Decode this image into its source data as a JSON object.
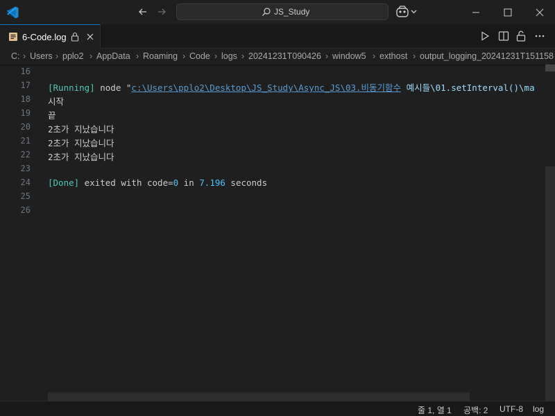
{
  "titlebar": {
    "search_label": "JS_Study",
    "icons": [
      "vscode-logo",
      "arrow-left-icon",
      "arrow-right-icon",
      "search-icon",
      "copilot-icon",
      "minimize-icon",
      "maximize-icon",
      "close-icon"
    ]
  },
  "tab": {
    "label": "6-Code.log",
    "icons": [
      "log-file-icon",
      "lock-icon",
      "close-icon"
    ]
  },
  "editor_actions": [
    "run-icon",
    "split-editor-icon",
    "unlock-icon",
    "more-icon"
  ],
  "breadcrumb": {
    "items": [
      "C:",
      "Users",
      "pplo2",
      "AppData",
      "Roaming",
      "Code",
      "logs",
      "20241231T090426",
      "window5",
      "exthost",
      "output_logging_20241231T151158"
    ]
  },
  "editor": {
    "lines": [
      {
        "num": "16",
        "parts": []
      },
      {
        "num": "17",
        "parts": [
          {
            "t": "[Running]",
            "c": "tk-bracket"
          },
          {
            "t": " node \"",
            "c": ""
          },
          {
            "t": "c:\\Users\\pplo2\\Desktop\\JS_Study\\Async_JS\\03.비동기함수",
            "c": "tk-link"
          },
          {
            "t": " 예시들\\01.setInterval()\\ma",
            "c": "tk-path"
          }
        ]
      },
      {
        "num": "18",
        "parts": [
          {
            "t": "시작",
            "c": ""
          }
        ]
      },
      {
        "num": "19",
        "parts": [
          {
            "t": "끝",
            "c": ""
          }
        ]
      },
      {
        "num": "20",
        "parts": [
          {
            "t": "2초가 지났습니다",
            "c": ""
          }
        ]
      },
      {
        "num": "21",
        "parts": [
          {
            "t": "2초가 지났습니다",
            "c": ""
          }
        ]
      },
      {
        "num": "22",
        "parts": [
          {
            "t": "2초가 지났습니다",
            "c": ""
          }
        ]
      },
      {
        "num": "23",
        "parts": []
      },
      {
        "num": "24",
        "parts": [
          {
            "t": "[Done]",
            "c": "tk-bracket"
          },
          {
            "t": " exited with code=",
            "c": ""
          },
          {
            "t": "0",
            "c": "tk-num"
          },
          {
            "t": " in ",
            "c": ""
          },
          {
            "t": "7.196",
            "c": "tk-num"
          },
          {
            "t": " seconds",
            "c": ""
          }
        ]
      },
      {
        "num": "25",
        "parts": []
      },
      {
        "num": "26",
        "parts": []
      }
    ]
  },
  "statusbar": {
    "position": "줄 1, 열 1",
    "spaces": "공백: 2",
    "encoding": "UTF-8",
    "language": "log"
  },
  "colors": {
    "accent": "#0078d4",
    "bracket": "#4ec9b0",
    "number": "#4fc1ff",
    "link": "#569cd6"
  }
}
